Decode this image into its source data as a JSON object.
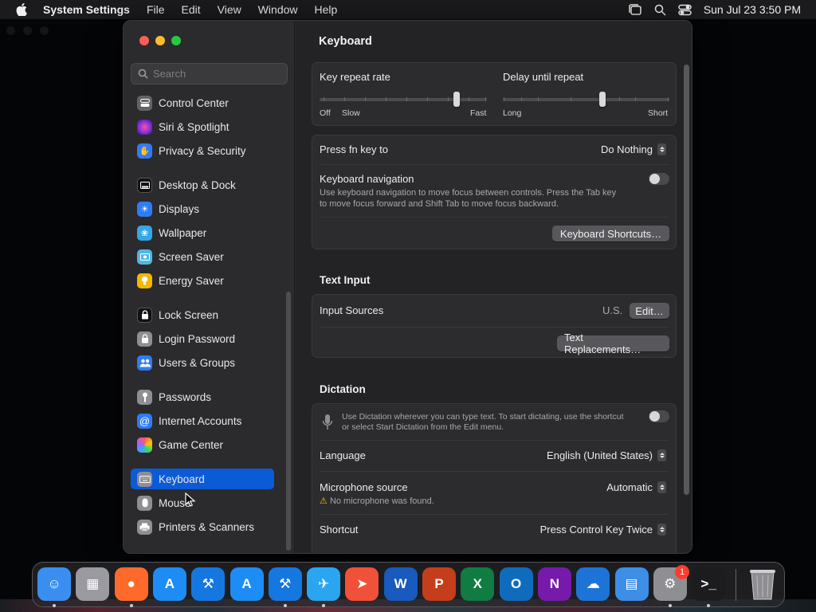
{
  "menubar": {
    "app_name": "System Settings",
    "menus": [
      "File",
      "Edit",
      "View",
      "Window",
      "Help"
    ],
    "clock": "Sun Jul 23  3:50 PM"
  },
  "sidebar": {
    "search_placeholder": "Search",
    "items": [
      {
        "label": "Control Center",
        "icon": "control-center-icon",
        "color": "#636366"
      },
      {
        "label": "Siri & Spotlight",
        "icon": "siri-icon",
        "color": "#b041d6"
      },
      {
        "label": "Privacy & Security",
        "icon": "hand-icon",
        "color": "#2f7cf6"
      },
      {
        "label": "Desktop & Dock",
        "icon": "dock-icon",
        "color": "#1c1c1e"
      },
      {
        "label": "Displays",
        "icon": "sun-icon",
        "color": "#2f7cf6"
      },
      {
        "label": "Wallpaper",
        "icon": "flower-icon",
        "color": "#35a7e6"
      },
      {
        "label": "Screen Saver",
        "icon": "screen-saver-icon",
        "color": "#4fb7e8"
      },
      {
        "label": "Energy Saver",
        "icon": "bulb-icon",
        "color": "#f5b700"
      },
      {
        "label": "Lock Screen",
        "icon": "lock-icon",
        "color": "#1c1c1e"
      },
      {
        "label": "Login Password",
        "icon": "lock-icon",
        "color": "#8e8e93"
      },
      {
        "label": "Users & Groups",
        "icon": "users-icon",
        "color": "#2f7cf6"
      },
      {
        "label": "Passwords",
        "icon": "key-icon",
        "color": "#8e8e93"
      },
      {
        "label": "Internet Accounts",
        "icon": "at-icon",
        "color": "#2f7cf6"
      },
      {
        "label": "Game Center",
        "icon": "game-center-icon",
        "color": "#ffffff"
      },
      {
        "label": "Keyboard",
        "icon": "keyboard-icon",
        "color": "#8e8e93",
        "selected": true
      },
      {
        "label": "Mouse",
        "icon": "mouse-icon",
        "color": "#8e8e93"
      },
      {
        "label": "Printers & Scanners",
        "icon": "printer-icon",
        "color": "#8e8e93"
      }
    ]
  },
  "content": {
    "title": "Keyboard",
    "key_repeat": {
      "label": "Key repeat rate",
      "min_labels": [
        "Off",
        "Slow"
      ],
      "max_label": "Fast",
      "value_pct": 82
    },
    "delay": {
      "label": "Delay until repeat",
      "min_label": "Long",
      "max_label": "Short",
      "value_pct": 60
    },
    "fn_key": {
      "label": "Press fn key to",
      "value": "Do Nothing"
    },
    "keyboard_nav": {
      "label": "Keyboard navigation",
      "desc1": "Use keyboard navigation to move focus between controls. Press the Tab key",
      "desc2": "to move focus forward and Shift Tab to move focus backward.",
      "on": false
    },
    "shortcuts_btn": "Keyboard Shortcuts…",
    "text_input": {
      "heading": "Text Input",
      "input_sources_label": "Input Sources",
      "input_sources_value": "U.S.",
      "edit_btn": "Edit…",
      "replacements_btn": "Text Replacements…"
    },
    "dictation": {
      "heading": "Dictation",
      "desc1": "Use Dictation wherever you can type text. To start dictating, use the shortcut",
      "desc2": "or select Start Dictation from the Edit menu.",
      "on": false,
      "language_label": "Language",
      "language_value": "English (United States)",
      "mic_label": "Microphone source",
      "mic_value": "Automatic",
      "mic_warning": "No microphone was found.",
      "shortcut_label": "Shortcut",
      "shortcut_value": "Press Control Key Twice"
    }
  },
  "dock": {
    "badge": "1",
    "apps": [
      {
        "name": "finder",
        "color": "#3a8ef0"
      },
      {
        "name": "launchpad",
        "color": "#9a9aa0"
      },
      {
        "name": "firefox",
        "color": "#ff6a2b"
      },
      {
        "name": "app-store",
        "color": "#1e8cf5"
      },
      {
        "name": "xcode",
        "color": "#1577e0"
      },
      {
        "name": "app-store-2",
        "color": "#1e8cf5"
      },
      {
        "name": "xcode-2",
        "color": "#1577e0"
      },
      {
        "name": "testflight",
        "color": "#2aa6f0"
      },
      {
        "name": "swift",
        "color": "#f05138"
      },
      {
        "name": "word",
        "color": "#185abd"
      },
      {
        "name": "powerpoint",
        "color": "#c43e1c"
      },
      {
        "name": "excel",
        "color": "#107c41"
      },
      {
        "name": "outlook",
        "color": "#0f6cbd"
      },
      {
        "name": "onenote",
        "color": "#7719aa"
      },
      {
        "name": "onedrive",
        "color": "#1e74d6"
      },
      {
        "name": "files",
        "color": "#3d8ee6"
      },
      {
        "name": "system-settings",
        "color": "#8e8e93"
      },
      {
        "name": "terminal",
        "color": "#1c1c1e"
      }
    ]
  }
}
